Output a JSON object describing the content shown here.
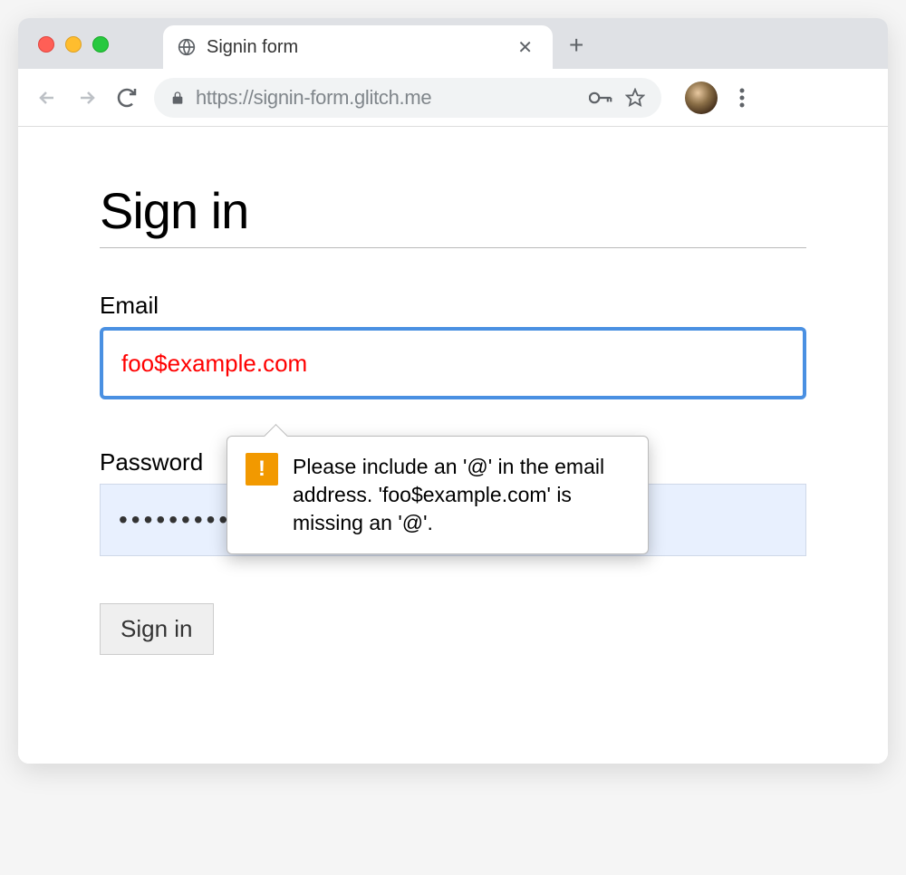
{
  "browser": {
    "tab_title": "Signin form",
    "url": "https://signin-form.glitch.me"
  },
  "page": {
    "heading": "Sign in",
    "email": {
      "label": "Email",
      "value": "foo$example.com"
    },
    "password": {
      "label": "Password",
      "value": "•••••••••"
    },
    "validation_message": "Please include an '@' in the email address. 'foo$example.com' is missing an '@'.",
    "submit_label": "Sign in"
  }
}
